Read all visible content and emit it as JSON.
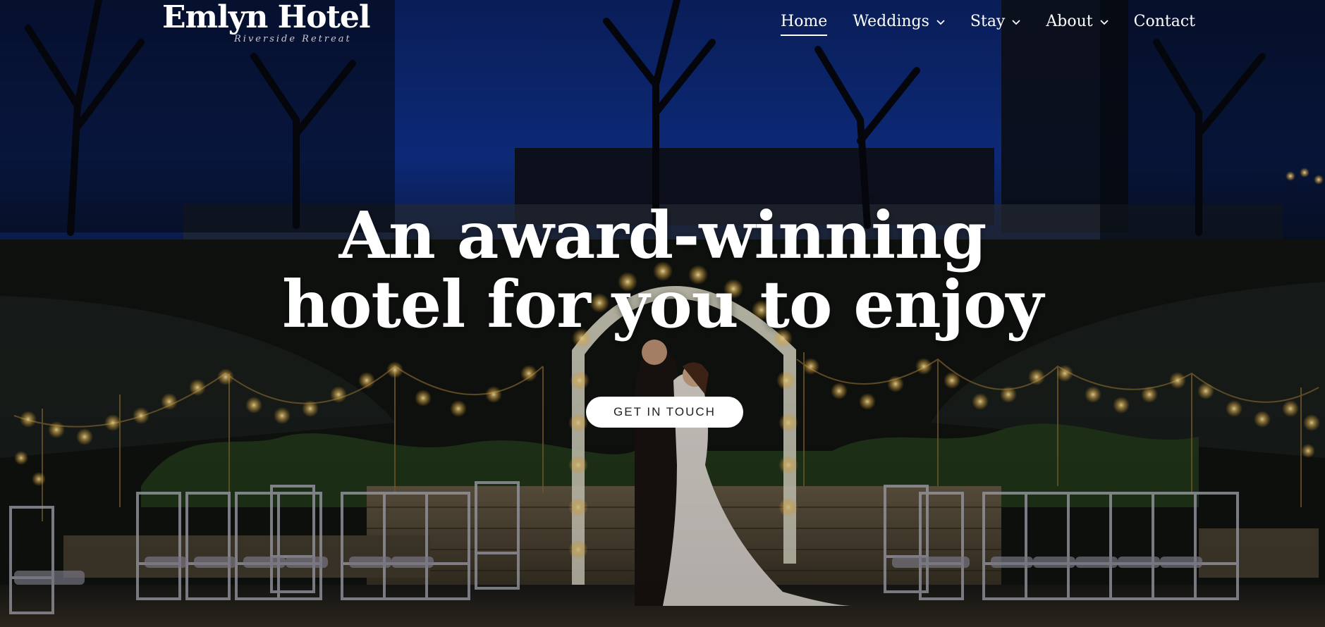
{
  "brand": {
    "name": "Emlyn Hotel",
    "tagline": "Riverside Retreat"
  },
  "nav": {
    "items": [
      {
        "label": "Home",
        "active": true,
        "has_dropdown": false
      },
      {
        "label": "Weddings",
        "active": false,
        "has_dropdown": true
      },
      {
        "label": "Stay",
        "active": false,
        "has_dropdown": true
      },
      {
        "label": "About",
        "active": false,
        "has_dropdown": true
      },
      {
        "label": "Contact",
        "active": false,
        "has_dropdown": false
      }
    ]
  },
  "hero": {
    "headline_line1": "An award-winning",
    "headline_line2": "hotel for you to enjoy",
    "cta_label": "GET IN TOUCH",
    "image_alt": "Wedding couple embracing under an illuminated floral arch at night, surrounded by string lights and rows of chairs"
  },
  "colors": {
    "text": "#ffffff",
    "button_bg": "#ffffff",
    "button_text": "#222222",
    "sky": "#0d2a6e"
  }
}
